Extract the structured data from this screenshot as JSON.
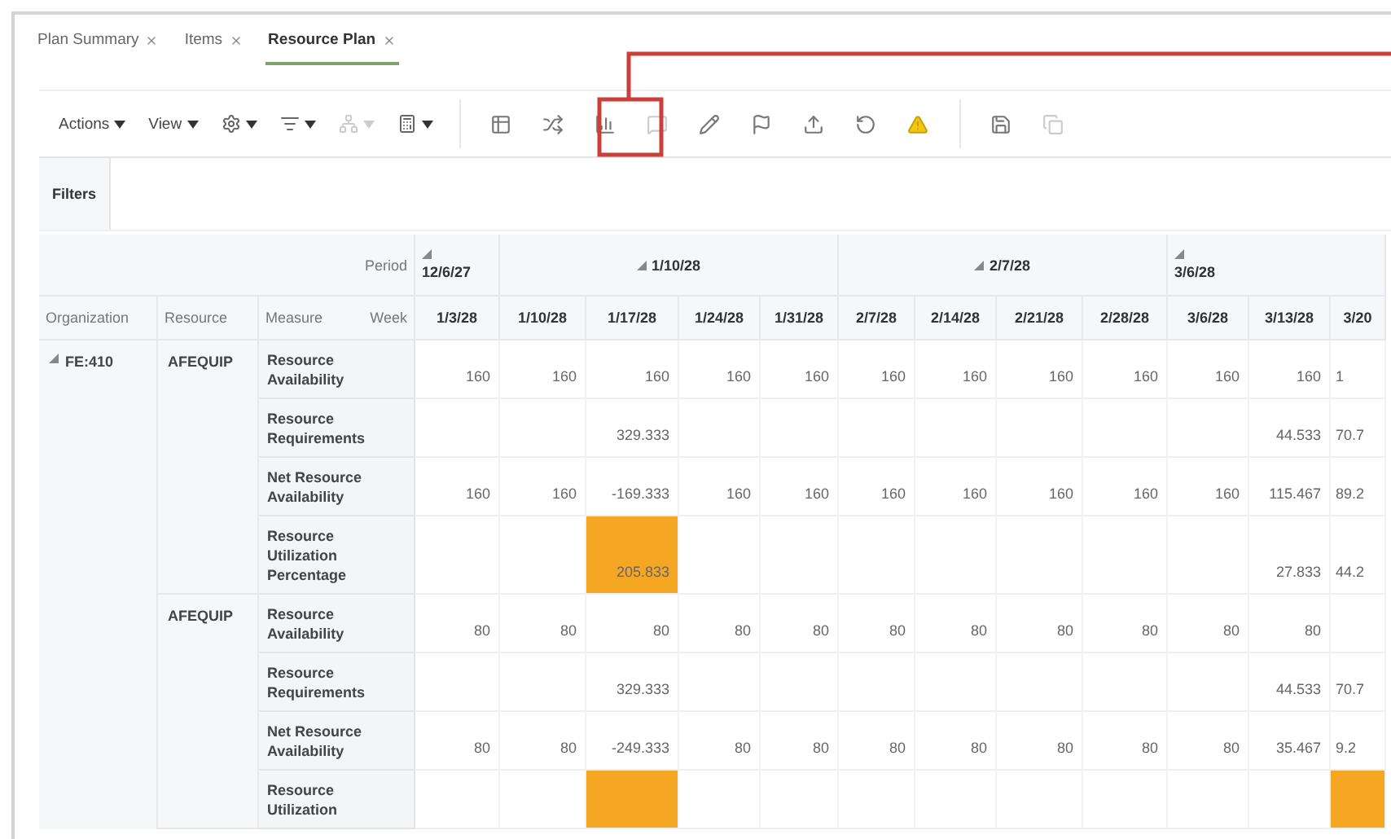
{
  "tabs": [
    {
      "label": "Plan Summary",
      "selected": false
    },
    {
      "label": "Items",
      "selected": false
    },
    {
      "label": "Resource Plan",
      "selected": true
    }
  ],
  "toolbar": {
    "menus": [
      {
        "label": "Actions"
      },
      {
        "label": "View"
      }
    ],
    "icon_menus": [
      {
        "disabled": false
      },
      {
        "disabled": false
      },
      {
        "disabled": true
      },
      {
        "disabled": false
      }
    ],
    "icon_buttons": [
      {
        "disabled": false
      },
      {
        "disabled": false
      },
      {
        "disabled": false
      },
      {
        "disabled": true
      },
      {
        "disabled": false
      },
      {
        "disabled": false
      },
      {
        "disabled": false
      },
      {
        "disabled": false
      },
      {
        "disabled": false
      },
      {
        "disabled": false
      },
      {
        "disabled": true
      }
    ]
  },
  "filters": {
    "label": "Filters"
  },
  "table": {
    "period_label": "Period",
    "week_label": "Week",
    "columns": [
      "Organization",
      "Resource",
      "Measure"
    ],
    "periods": [
      {
        "label": "12/6/27",
        "expanded": true,
        "weeks": [
          "1/3/28"
        ]
      },
      {
        "label": "1/10/28",
        "expanded": true,
        "weeks": [
          "1/10/28",
          "1/17/28",
          "1/24/28",
          "1/31/28"
        ]
      },
      {
        "label": "2/7/28",
        "expanded": true,
        "weeks": [
          "2/7/28",
          "2/14/28",
          "2/21/28",
          "2/28/28"
        ]
      },
      {
        "label": "3/6/28",
        "expanded": true,
        "weeks": [
          "3/6/28",
          "3/13/28",
          "3/20"
        ]
      }
    ],
    "organizations": [
      {
        "name": "FE:410",
        "expanded": true,
        "resources": [
          {
            "name": "AFEQUIP",
            "measures": [
              {
                "name": "Resource Availability",
                "cells": [
                  {
                    "value": "160",
                    "highlighted": false
                  },
                  {
                    "value": "160",
                    "highlighted": false
                  },
                  {
                    "value": "160",
                    "highlighted": false
                  },
                  {
                    "value": "160",
                    "highlighted": false
                  },
                  {
                    "value": "160",
                    "highlighted": false
                  },
                  {
                    "value": "160",
                    "highlighted": false
                  },
                  {
                    "value": "160",
                    "highlighted": false
                  },
                  {
                    "value": "160",
                    "highlighted": false
                  },
                  {
                    "value": "160",
                    "highlighted": false
                  },
                  {
                    "value": "160",
                    "highlighted": false
                  },
                  {
                    "value": "160",
                    "highlighted": false
                  },
                  {
                    "value": "1",
                    "highlighted": false
                  }
                ]
              },
              {
                "name": "Resource Requirements",
                "cells": [
                  {
                    "highlighted": false
                  },
                  {
                    "highlighted": false
                  },
                  {
                    "value": "329.333",
                    "highlighted": false
                  },
                  {
                    "highlighted": false
                  },
                  {
                    "highlighted": false
                  },
                  {
                    "highlighted": false
                  },
                  {
                    "highlighted": false
                  },
                  {
                    "highlighted": false
                  },
                  {
                    "highlighted": false
                  },
                  {
                    "highlighted": false
                  },
                  {
                    "value": "44.533",
                    "highlighted": false
                  },
                  {
                    "value": "70.7",
                    "highlighted": false
                  }
                ]
              },
              {
                "name": "Net Resource Availability",
                "cells": [
                  {
                    "value": "160",
                    "highlighted": false
                  },
                  {
                    "value": "160",
                    "highlighted": false
                  },
                  {
                    "value": "-169.333",
                    "highlighted": false
                  },
                  {
                    "value": "160",
                    "highlighted": false
                  },
                  {
                    "value": "160",
                    "highlighted": false
                  },
                  {
                    "value": "160",
                    "highlighted": false
                  },
                  {
                    "value": "160",
                    "highlighted": false
                  },
                  {
                    "value": "160",
                    "highlighted": false
                  },
                  {
                    "value": "160",
                    "highlighted": false
                  },
                  {
                    "value": "160",
                    "highlighted": false
                  },
                  {
                    "value": "115.467",
                    "highlighted": false
                  },
                  {
                    "value": "89.2",
                    "highlighted": false
                  }
                ]
              },
              {
                "name": "Resource Utilization Percentage",
                "cells": [
                  {
                    "highlighted": false
                  },
                  {
                    "highlighted": false
                  },
                  {
                    "value": "205.833",
                    "highlighted": true
                  },
                  {
                    "highlighted": false
                  },
                  {
                    "highlighted": false
                  },
                  {
                    "highlighted": false
                  },
                  {
                    "highlighted": false
                  },
                  {
                    "highlighted": false
                  },
                  {
                    "highlighted": false
                  },
                  {
                    "highlighted": false
                  },
                  {
                    "value": "27.833",
                    "highlighted": false
                  },
                  {
                    "value": "44.2",
                    "highlighted": false
                  }
                ]
              }
            ]
          },
          {
            "name": "AFEQUIP",
            "measures": [
              {
                "name": "Resource Availability",
                "cells": [
                  {
                    "value": "80",
                    "highlighted": false
                  },
                  {
                    "value": "80",
                    "highlighted": false
                  },
                  {
                    "value": "80",
                    "highlighted": false
                  },
                  {
                    "value": "80",
                    "highlighted": false
                  },
                  {
                    "value": "80",
                    "highlighted": false
                  },
                  {
                    "value": "80",
                    "highlighted": false
                  },
                  {
                    "value": "80",
                    "highlighted": false
                  },
                  {
                    "value": "80",
                    "highlighted": false
                  },
                  {
                    "value": "80",
                    "highlighted": false
                  },
                  {
                    "value": "80",
                    "highlighted": false
                  },
                  {
                    "value": "80",
                    "highlighted": false
                  },
                  {
                    "highlighted": false
                  }
                ]
              },
              {
                "name": "Resource Requirements",
                "cells": [
                  {
                    "highlighted": false
                  },
                  {
                    "highlighted": false
                  },
                  {
                    "value": "329.333",
                    "highlighted": false
                  },
                  {
                    "highlighted": false
                  },
                  {
                    "highlighted": false
                  },
                  {
                    "highlighted": false
                  },
                  {
                    "highlighted": false
                  },
                  {
                    "highlighted": false
                  },
                  {
                    "highlighted": false
                  },
                  {
                    "highlighted": false
                  },
                  {
                    "value": "44.533",
                    "highlighted": false
                  },
                  {
                    "value": "70.7",
                    "highlighted": false
                  }
                ]
              },
              {
                "name": "Net Resource Availability",
                "cells": [
                  {
                    "value": "80",
                    "highlighted": false
                  },
                  {
                    "value": "80",
                    "highlighted": false
                  },
                  {
                    "value": "-249.333",
                    "highlighted": false
                  },
                  {
                    "value": "80",
                    "highlighted": false
                  },
                  {
                    "value": "80",
                    "highlighted": false
                  },
                  {
                    "value": "80",
                    "highlighted": false
                  },
                  {
                    "value": "80",
                    "highlighted": false
                  },
                  {
                    "value": "80",
                    "highlighted": false
                  },
                  {
                    "value": "80",
                    "highlighted": false
                  },
                  {
                    "value": "80",
                    "highlighted": false
                  },
                  {
                    "value": "35.467",
                    "highlighted": false
                  },
                  {
                    "value": "9.2",
                    "highlighted": false
                  }
                ]
              },
              {
                "name": "Resource Utilization",
                "cells": [
                  {
                    "highlighted": false
                  },
                  {
                    "highlighted": false
                  },
                  {
                    "highlighted": true
                  },
                  {
                    "highlighted": false
                  },
                  {
                    "highlighted": false
                  },
                  {
                    "highlighted": false
                  },
                  {
                    "highlighted": false
                  },
                  {
                    "highlighted": false
                  },
                  {
                    "highlighted": false
                  },
                  {
                    "highlighted": false
                  },
                  {
                    "highlighted": false
                  },
                  {
                    "highlighted": true
                  }
                ]
              }
            ]
          }
        ]
      }
    ]
  }
}
